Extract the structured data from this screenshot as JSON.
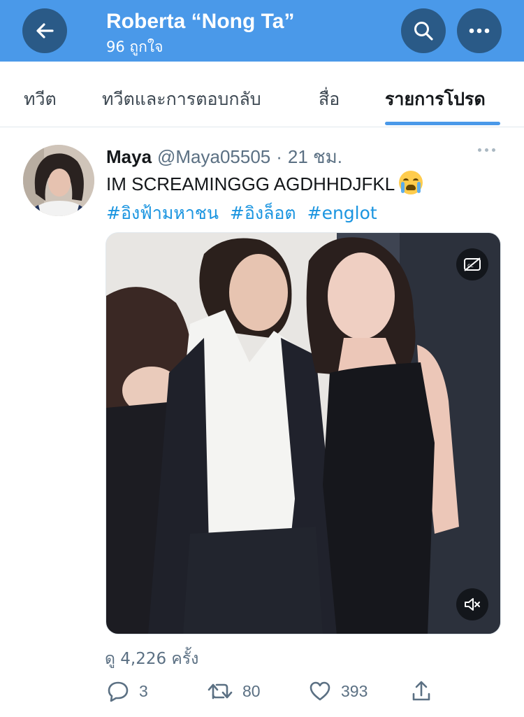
{
  "header": {
    "title": "Roberta “Nong Ta”",
    "subtitle": "96 ถูกใจ",
    "accent_color": "#4a99e9",
    "icons": [
      "back-arrow-icon",
      "search-icon",
      "more-icon"
    ]
  },
  "tabs": [
    {
      "label": "ทวีต",
      "active": false
    },
    {
      "label": "ทวีตและการตอบกลับ",
      "active": false
    },
    {
      "label": "สื่อ",
      "active": false
    },
    {
      "label": "รายการโปรด",
      "active": true
    }
  ],
  "tweet": {
    "name": "Maya",
    "handle": "@Maya05505",
    "separator": "·",
    "time": "21 ชม.",
    "text": "IM SCREAMINGGG AGDHHDJFKL",
    "emoji": "loudly-crying-face",
    "hashtags": [
      "#อิงฟ้ามหาชน",
      "#อิงล็อต",
      "#englot"
    ],
    "views": "ดู 4,226 ครั้ง",
    "replies": "3",
    "retweets": "80",
    "likes": "393",
    "link_color": "#1b95e0"
  }
}
